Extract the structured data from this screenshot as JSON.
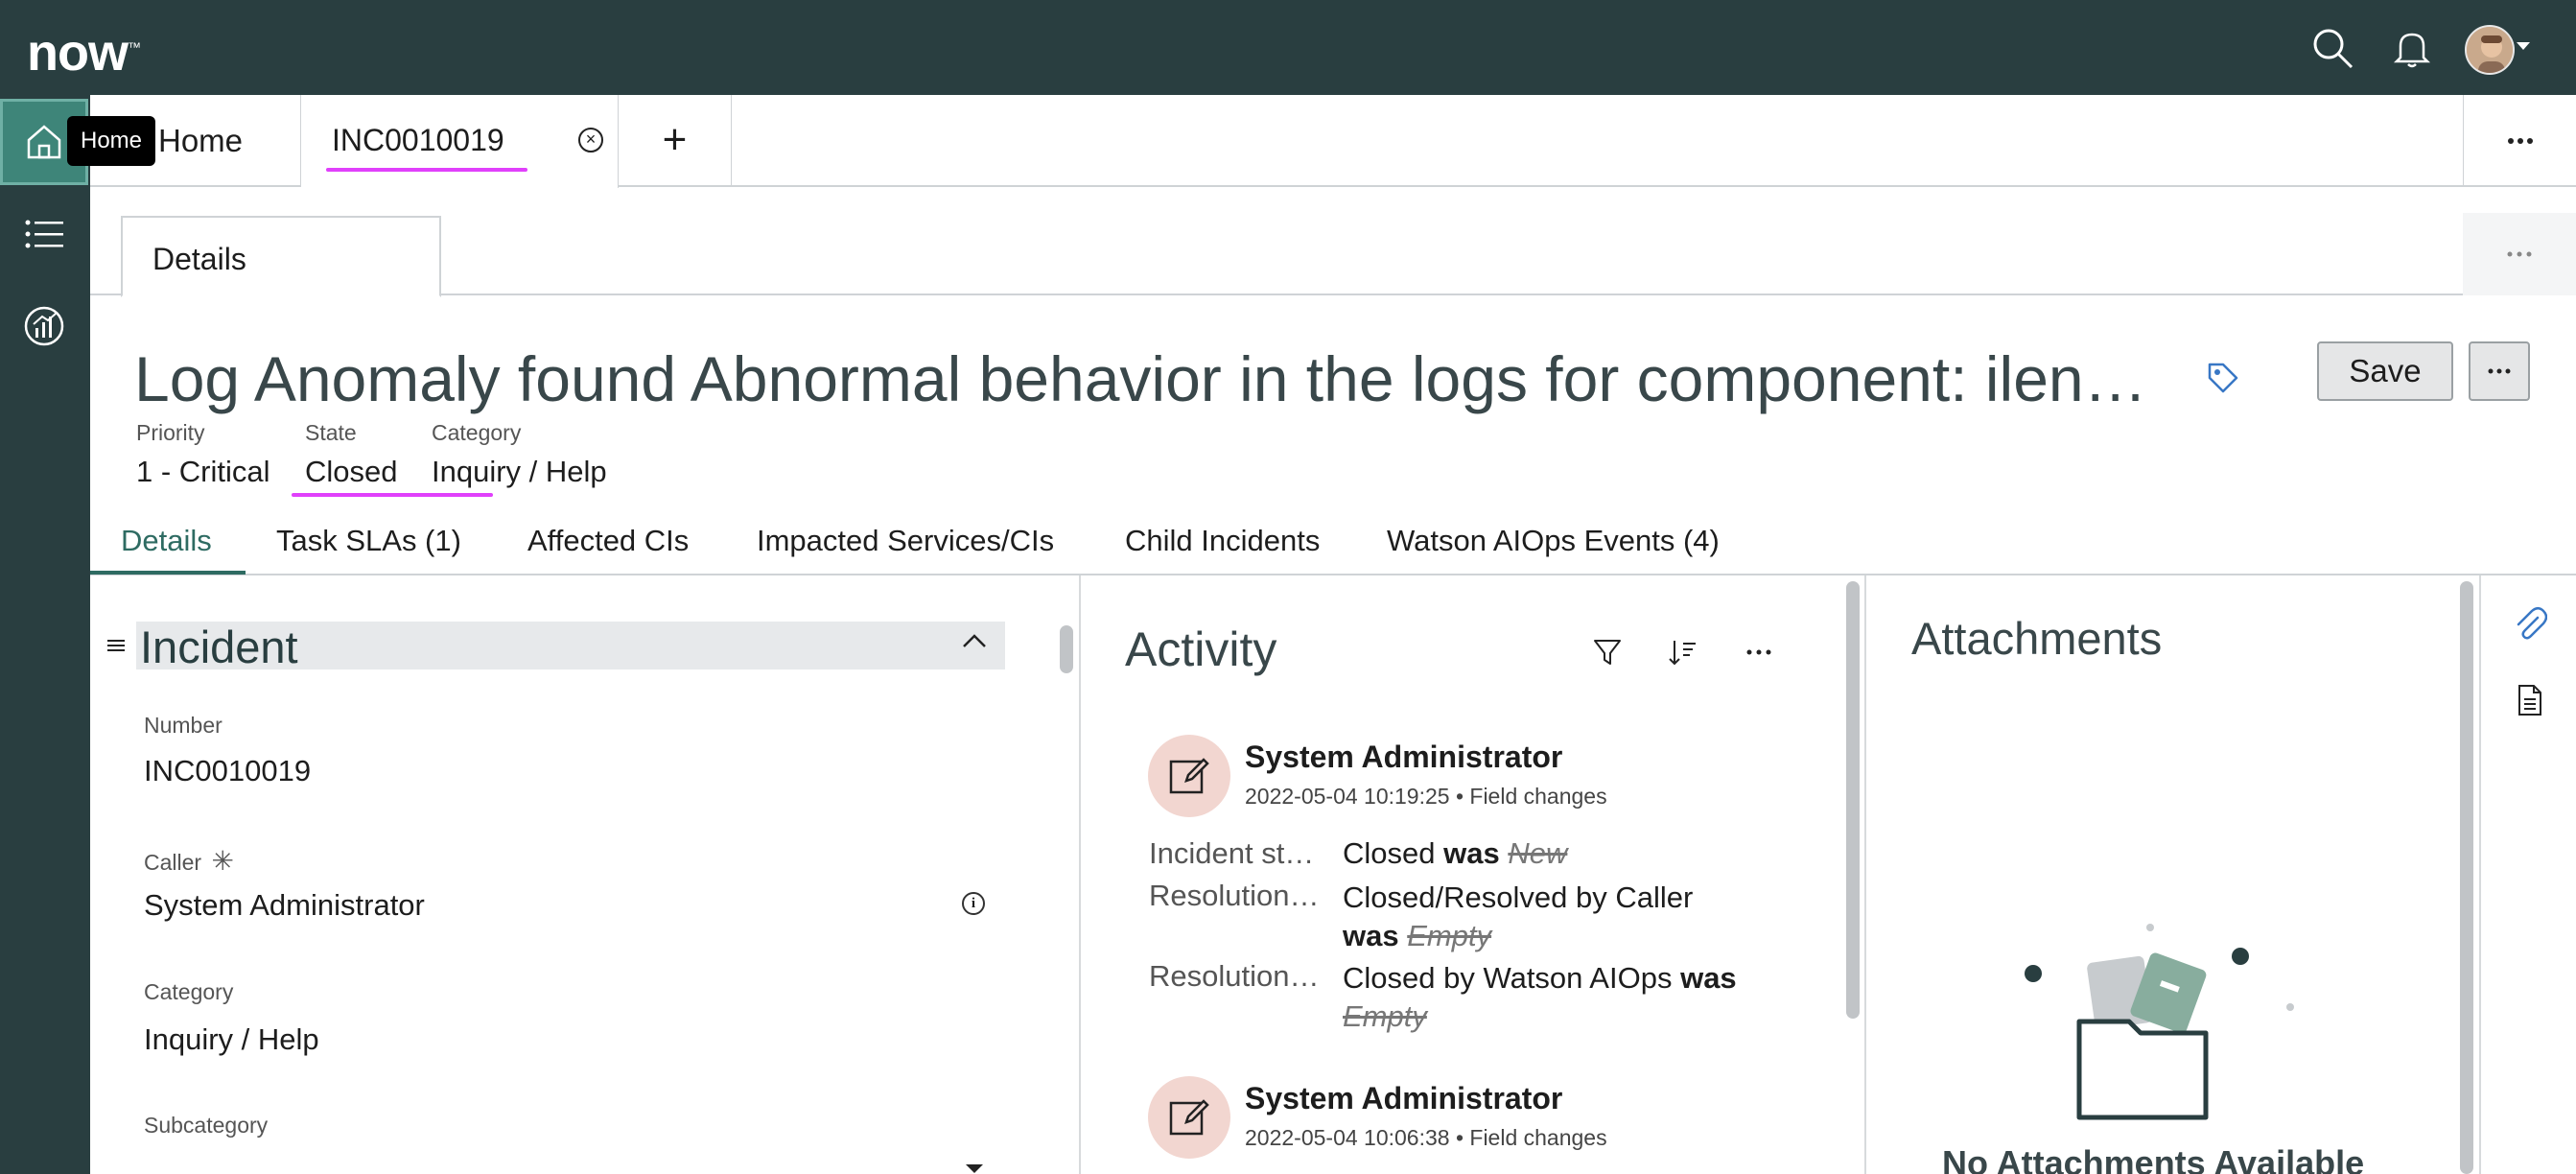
{
  "app": {
    "logo_text": "now",
    "logo_mark": "™"
  },
  "topbar": {
    "icons": [
      "search-icon",
      "bell-icon",
      "avatar"
    ]
  },
  "leftrail": {
    "items": [
      "home-icon",
      "list-icon",
      "analytics-icon"
    ],
    "tooltip": "Home"
  },
  "tabs": {
    "home_label": "Home",
    "record_label": "INC0010019",
    "close_glyph": "⊗",
    "add_glyph": "+"
  },
  "details_tab": {
    "label": "Details"
  },
  "record": {
    "title": "Log Anomaly found Abnormal behavior in the logs for component: ilende…",
    "save_label": "Save",
    "meta": [
      {
        "label": "Priority",
        "value": "1 - Critical"
      },
      {
        "label": "State",
        "value": "Closed"
      },
      {
        "label": "Category",
        "value": "Inquiry / Help"
      }
    ]
  },
  "section_tabs": [
    "Details",
    "Task SLAs (1)",
    "Affected CIs",
    "Impacted Services/CIs",
    "Child Incidents",
    "Watson AIOps Events (4)"
  ],
  "incident": {
    "title": "Incident",
    "fields": [
      {
        "label": "Number",
        "value": "INC0010019"
      },
      {
        "label": "Caller",
        "value": "System Administrator",
        "required_mark": "✳"
      },
      {
        "label": "Category",
        "value": "Inquiry / Help"
      },
      {
        "label": "Subcategory",
        "value": ""
      }
    ]
  },
  "activity": {
    "title": "Activity",
    "entries": [
      {
        "author": "System Administrator",
        "meta": "2022-05-04 10:19:25 • Field changes",
        "changes": [
          {
            "label": "Incident st…",
            "new": "Closed",
            "was": "was",
            "old": "New"
          },
          {
            "label": "Resolution…",
            "new": "Closed/Resolved by Caller",
            "was": "was",
            "old": "Empty"
          },
          {
            "label": "Resolution…",
            "new": "Closed by Watson AIOps",
            "was": "was",
            "old": "Empty"
          }
        ]
      },
      {
        "author": "System Administrator",
        "meta": "2022-05-04 10:06:38 • Field changes"
      }
    ]
  },
  "attachments": {
    "title": "Attachments",
    "empty_text": "No Attachments Available"
  },
  "colors": {
    "chrome": "#293e40",
    "home_active": "#3e8579",
    "highlight_underline": "#e040fb",
    "active_tab_line": "#2e6b62"
  }
}
